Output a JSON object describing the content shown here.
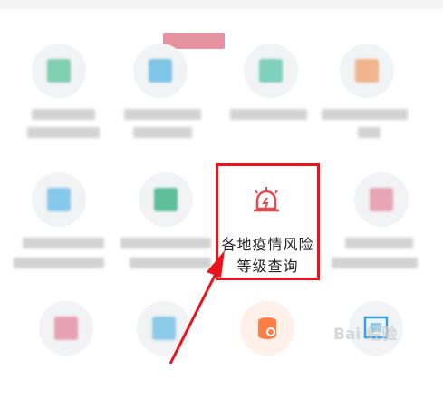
{
  "header": {
    "highlight_bar": "#d13b54"
  },
  "highlighted_item": {
    "line1": "各地疫情风险",
    "line2": "等级查询",
    "icon": "alarm-siren-icon",
    "border_color": "#e8131d"
  },
  "watermark": {
    "text": "Bai  经验"
  },
  "annotation": {
    "arrow_color": "#e8131d"
  },
  "grid": {
    "row1": [
      "green",
      "blue",
      "green",
      "orange"
    ],
    "row2": [
      "blue",
      "green",
      "siren",
      "pink"
    ],
    "row3": [
      "pink",
      "blue",
      "database",
      "scan"
    ]
  }
}
